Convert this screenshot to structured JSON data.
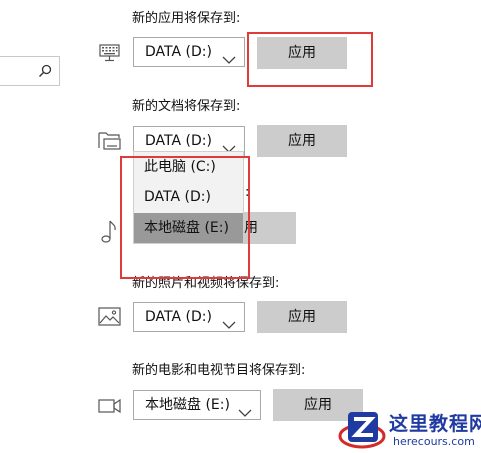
{
  "sections": [
    {
      "title": "新的应用将保存到:",
      "icon": "monitor-keyboard-icon",
      "selected": "DATA (D:)",
      "apply_label": "应用"
    },
    {
      "title": "新的文档将保存到:",
      "icon": "folder-drive-icon",
      "selected": "DATA (D:)",
      "apply_label": "应用"
    },
    {
      "title_tail": "到:",
      "icon": "music-note-icon",
      "apply_label_partial": "应用"
    },
    {
      "title": "新的照片和视频将保存到:",
      "icon": "image-icon",
      "selected": "DATA (D:)",
      "apply_label": "应用"
    },
    {
      "title": "新的电影和电视节目将保存到:",
      "icon": "video-camera-icon",
      "selected": "本地磁盘 (E:)",
      "apply_label": "应用"
    }
  ],
  "dropdown_open": {
    "options": [
      "此电脑 (C:)",
      "DATA (D:)",
      "本地磁盘 (E:)"
    ],
    "selected_index": 2
  },
  "watermark": {
    "main": "这里教程网",
    "sub": "herecours.com"
  },
  "colors": {
    "button_bg": "#cccccc",
    "highlight_red": "#e03a3a",
    "selected_option_bg": "#999999",
    "watermark_blue": "#1f3aa0"
  }
}
